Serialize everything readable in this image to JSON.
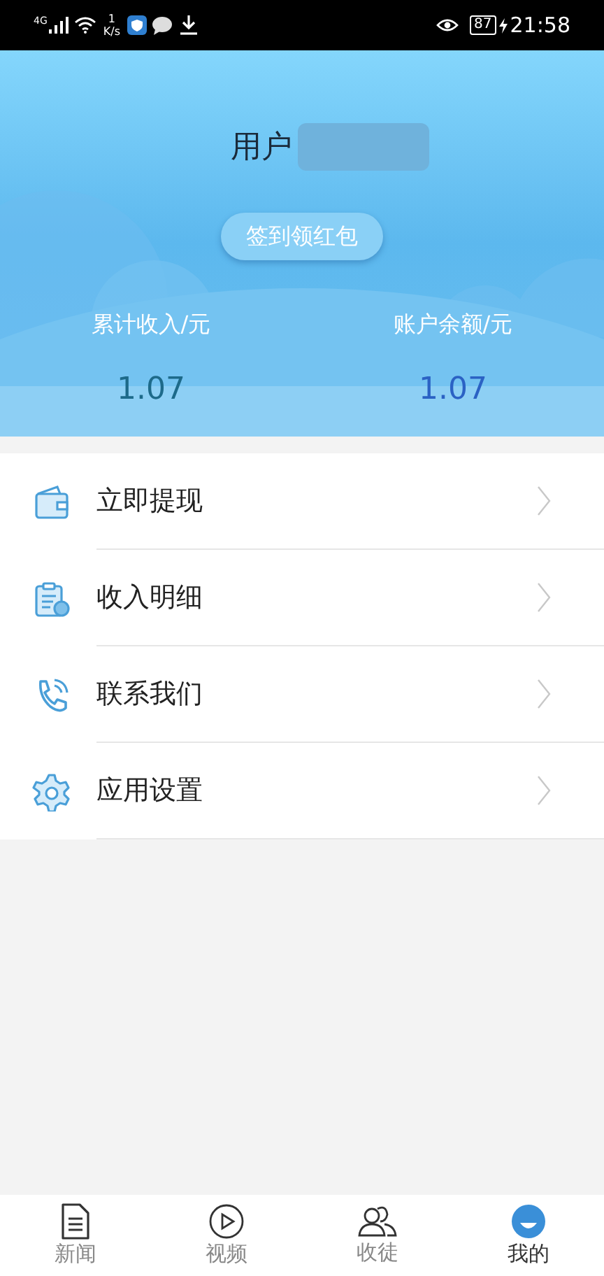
{
  "status_bar": {
    "network": "4G",
    "speed_value": "1",
    "speed_unit": "K/s",
    "battery": "87",
    "time": "21:58"
  },
  "profile": {
    "user_label": "用户",
    "name_redacted": true,
    "checkin_button": "签到领红包"
  },
  "stats": [
    {
      "label": "累计收入/元",
      "value": "1.07",
      "color": "#1d6a8a"
    },
    {
      "label": "账户余额/元",
      "value": "1.07",
      "color": "#2b62c4"
    }
  ],
  "menu": [
    {
      "kind": "wallet",
      "label": "立即提现"
    },
    {
      "kind": "receipt",
      "label": "收入明细"
    },
    {
      "kind": "phone",
      "label": "联系我们"
    },
    {
      "kind": "settings",
      "label": "应用设置"
    }
  ],
  "tabs": [
    {
      "kind": "news",
      "label": "新闻",
      "selected": false
    },
    {
      "kind": "video",
      "label": "视频",
      "selected": false
    },
    {
      "kind": "apprentice",
      "label": "收徒",
      "selected": false
    },
    {
      "kind": "me",
      "label": "我的",
      "selected": true
    }
  ]
}
